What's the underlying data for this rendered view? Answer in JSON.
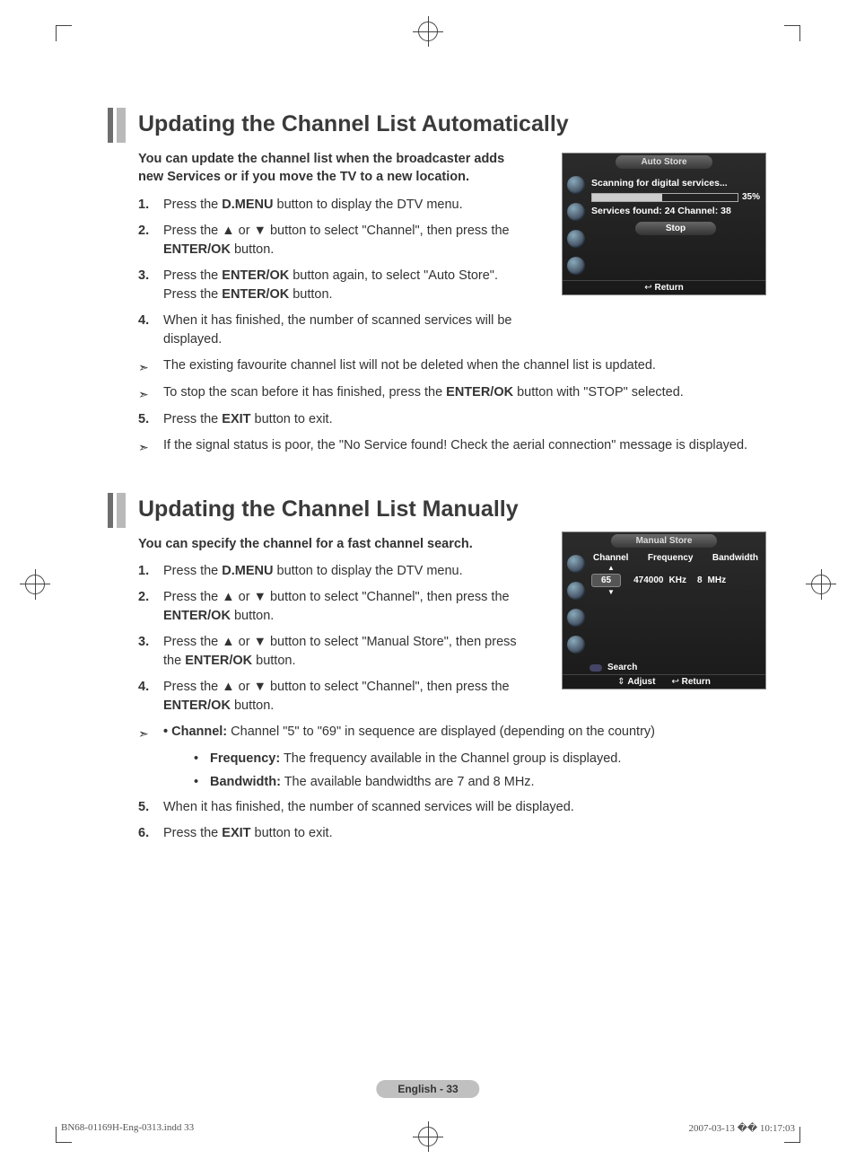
{
  "section1": {
    "heading": "Updating the Channel List Automatically",
    "intro": "You can update the channel list when the broadcaster adds new Services or if you move the TV to a new location.",
    "steps": {
      "s1_a": "Press the ",
      "s1_b": "D.MENU",
      "s1_c": " button to display the DTV menu.",
      "s2_a": "Press the ▲ or ▼ button to select \"Channel\", then press the ",
      "s2_b": "ENTER/OK",
      "s2_c": " button.",
      "s3_a": "Press the ",
      "s3_b": "ENTER/OK",
      "s3_c": " button again, to select \"Auto Store\". Press the ",
      "s3_d": "ENTER/OK",
      "s3_e": " button.",
      "s4": "When it has finished, the number of scanned services will be displayed.",
      "n1": "The existing favourite channel list will not be deleted when the channel list is updated.",
      "n2_a": "To stop the scan before it has finished, press the ",
      "n2_b": "ENTER/OK",
      "n2_c": " button with \"STOP\" selected.",
      "s5_a": "Press the ",
      "s5_b": "EXIT",
      "s5_c": " button to exit.",
      "n3": "If the signal status is poor, the \"No Service found! Check the aerial connection\" message is displayed."
    },
    "osd": {
      "title": "Auto Store",
      "scanning": "Scanning for digital services...",
      "percent": "35%",
      "progress_fill": 48,
      "services": "Services found: 24    Channel: 38",
      "stop": "Stop",
      "return": "Return"
    }
  },
  "section2": {
    "heading": "Updating the Channel List Manually",
    "intro": "You can specify the channel for a fast channel search.",
    "steps": {
      "s1_a": "Press the ",
      "s1_b": "D.MENU",
      "s1_c": " button to display the DTV menu.",
      "s2_a": "Press the ▲ or ▼ button to select \"Channel\", then press the ",
      "s2_b": "ENTER/OK",
      "s2_c": " button.",
      "s3_a": "Press the ▲ or ▼ button to select \"Manual Store\", then press the ",
      "s3_b": "ENTER/OK",
      "s3_c": " button.",
      "s4_a": "Press the ▲ or ▼ button to select \"Channel\", then press the ",
      "s4_b": "ENTER/OK",
      "s4_c": " button.",
      "sub1_b": "Channel:",
      "sub1_t": " Channel \"5\" to \"69\" in sequence are displayed (depending on the country)",
      "sub2_b": "Frequency:",
      "sub2_t": " The frequency available in the Channel group is displayed.",
      "sub3_b": "Bandwidth:",
      "sub3_t": " The available bandwidths are 7 and 8 MHz.",
      "s5": "When it has finished, the number of scanned services will be displayed.",
      "s6_a": "Press the ",
      "s6_b": "EXIT",
      "s6_c": " button to exit."
    },
    "osd": {
      "title": "Manual Store",
      "col1": "Channel",
      "col2": "Frequency",
      "col3": "Bandwidth",
      "val_channel": "65",
      "val_freq": "474000",
      "val_khz": "KHz",
      "val_bw": "8",
      "val_mhz": "MHz",
      "search": "Search",
      "adjust": "Adjust",
      "return": "Return"
    }
  },
  "footer": {
    "page": "English - 33",
    "file": "BN68-01169H-Eng-0313.indd   33",
    "datetime": "2007-03-13   �� 10:17:03"
  },
  "nums": {
    "n1": "1.",
    "n2": "2.",
    "n3": "3.",
    "n4": "4.",
    "n5": "5.",
    "n6": "6."
  },
  "glyphs": {
    "arrow": "➣",
    "bullet": "•",
    "updown": "⇕",
    "ret": "↩"
  }
}
